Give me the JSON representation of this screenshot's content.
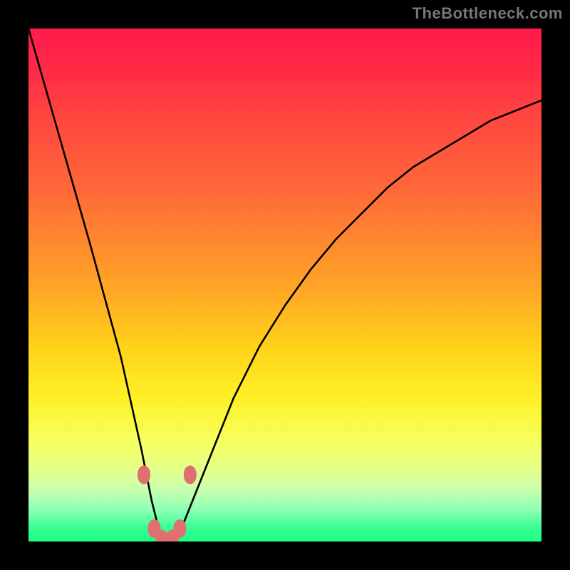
{
  "watermark": "TheBottleneck.com",
  "chart_data": {
    "type": "line",
    "title": "",
    "xlabel": "",
    "ylabel": "",
    "xlim": [
      0,
      100
    ],
    "ylim": [
      0,
      100
    ],
    "series": [
      {
        "name": "bottleneck-curve",
        "x": [
          0,
          4,
          8,
          12,
          15,
          18,
          20,
          22,
          23,
          24,
          25,
          26,
          27,
          28,
          29,
          30,
          32,
          36,
          40,
          45,
          50,
          55,
          60,
          65,
          70,
          75,
          80,
          85,
          90,
          95,
          100
        ],
        "y": [
          100,
          86,
          72,
          58,
          47,
          36,
          27,
          18,
          13,
          8,
          4,
          1,
          0,
          0,
          1,
          3,
          8,
          18,
          28,
          38,
          46,
          53,
          59,
          64,
          69,
          73,
          76,
          79,
          82,
          84,
          86
        ]
      }
    ],
    "markers": [
      {
        "name": "point-a",
        "x": 22.5,
        "y": 13
      },
      {
        "name": "point-b",
        "x": 24.5,
        "y": 2.5
      },
      {
        "name": "point-c",
        "x": 26,
        "y": 0.5
      },
      {
        "name": "point-d",
        "x": 28,
        "y": 0.5
      },
      {
        "name": "point-e",
        "x": 29.5,
        "y": 2.5
      },
      {
        "name": "point-f",
        "x": 31.5,
        "y": 13
      }
    ],
    "marker_color": "#e06f6f",
    "curve_color": "#000000"
  }
}
